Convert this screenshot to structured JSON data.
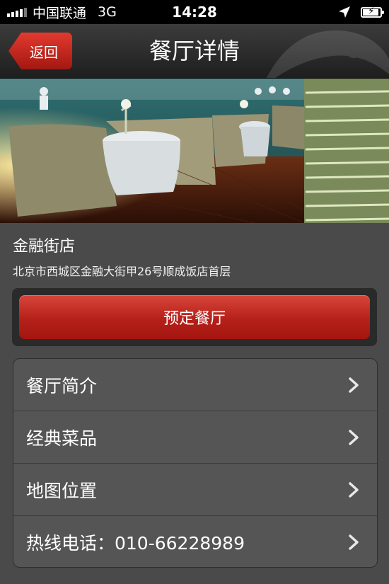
{
  "status_bar": {
    "carrier": "中国联通",
    "network": "3G",
    "time": "14:28",
    "signal_bars": 4,
    "battery_level": 0.85,
    "icons": [
      "signal-icon",
      "location-arrow-icon",
      "battery-charging-icon"
    ]
  },
  "nav": {
    "back_label": "返回",
    "title": "餐厅详情"
  },
  "restaurant": {
    "name": "金融街店",
    "address": "北京市西城区金融大街甲26号顺成饭店首层"
  },
  "reserve_label": "预定餐厅",
  "menu": {
    "items": [
      {
        "label": "餐厅简介",
        "icon": "chevron-right-icon"
      },
      {
        "label": "经典菜品",
        "icon": "chevron-right-icon"
      },
      {
        "label": "地图位置",
        "icon": "chevron-right-icon"
      },
      {
        "label": "热线电话：010-66228989",
        "icon": "chevron-right-icon"
      }
    ]
  },
  "colors": {
    "accent_red": "#b5201a",
    "background": "#4a4a4a",
    "nav_bar": "#2a2a2a"
  }
}
